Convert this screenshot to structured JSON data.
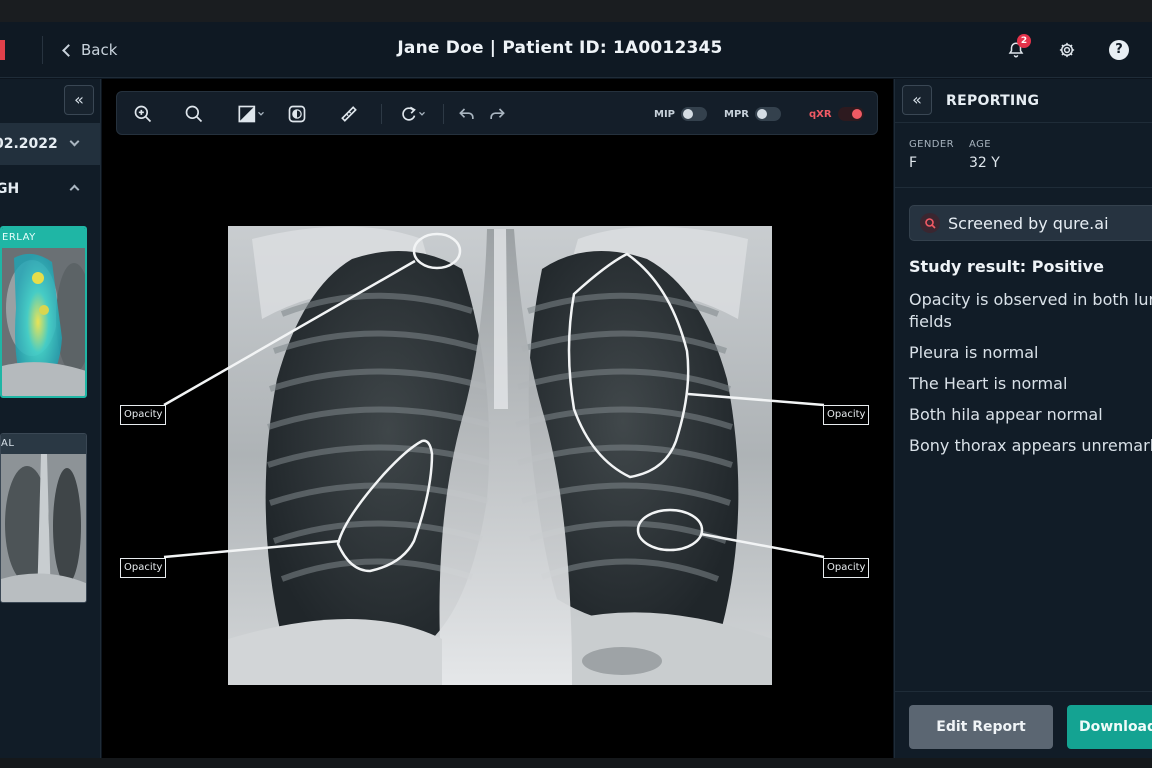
{
  "header": {
    "back_label": "Back",
    "title": "Jane Doe | Patient ID: 1A0012345",
    "notification_count": "2",
    "help_label": "?"
  },
  "left_panel": {
    "collapse_label": "«",
    "study_date": "02.2022",
    "series_name": "GH",
    "thumbnails": [
      {
        "label": "ERLAY"
      },
      {
        "label": "AL"
      }
    ]
  },
  "toolbar": {
    "toggles": [
      {
        "label": "MIP",
        "on": false
      },
      {
        "label": "MPR",
        "on": false
      },
      {
        "label": "qXR",
        "on": true
      }
    ]
  },
  "annotations": {
    "labels": [
      "Opacity",
      "Opacity",
      "Opacity",
      "Opacity"
    ]
  },
  "report": {
    "collapse_label": "«",
    "title": "REPORTING",
    "gender_label": "GENDER",
    "gender_value": "F",
    "age_label": "AGE",
    "age_value": "32 Y",
    "screened_by": "Screened by qure.ai",
    "study_result": "Study result: Positive",
    "findings": [
      "Opacity is observed in both lung fields",
      "Pleura is normal",
      "The Heart is normal",
      "Both hila appear normal",
      "Bony thorax appears unremarkable"
    ],
    "edit_button": "Edit Report",
    "download_button": "Download"
  },
  "colors": {
    "accent_teal": "#14a392",
    "alert_red": "#e5324a",
    "panel_bg": "#111c27"
  }
}
